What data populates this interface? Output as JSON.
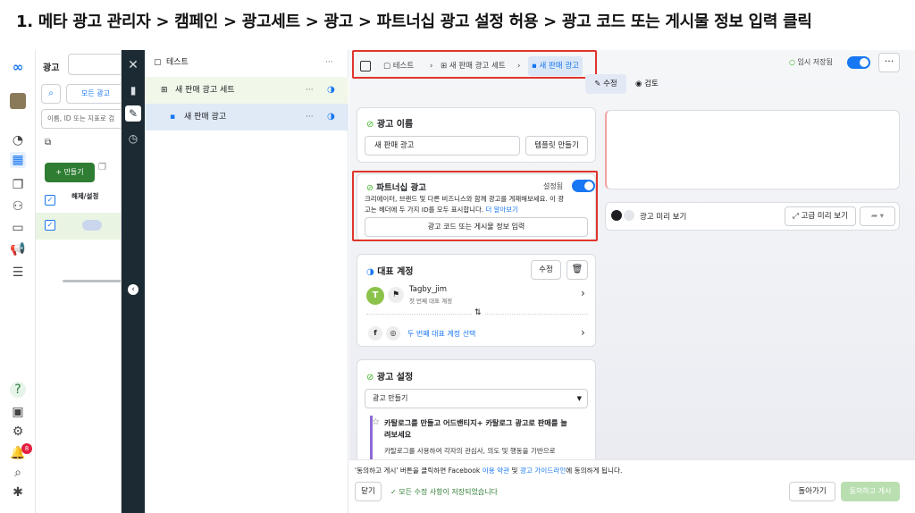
{
  "caption": "1. 메타 광고 관리자 > 캠페인 > 광고세트 > 광고 > 파트너십 광고 설정 허용 > 광고 코드 또는 게시물 정보 입력 클릭",
  "left": {
    "tab": "광고",
    "search_placeholder": "이름, ID 또는 지표로 검",
    "all_ads": "모든 광고",
    "create": "+ 만들기",
    "col_header": "해제/설정"
  },
  "tree": {
    "campaign": "테스트",
    "adset": "새 판매 광고 세트",
    "ad": "새 판매 광고"
  },
  "breadcrumb": {
    "campaign": "테스트",
    "adset": "새 판매 광고 세트",
    "ad": "새 판매 광고"
  },
  "header": {
    "saved": "임시 저장됨",
    "edit_tab": "수정",
    "review_tab": "검토"
  },
  "ad_name": {
    "title": "광고 이름",
    "value": "새 판매 광고",
    "template_btn": "템플릿 만들기"
  },
  "partnership": {
    "title": "파트너십 광고",
    "status": "설정됨",
    "desc1": "크리에이터, 브랜드 및 다른 비즈니스와 함께 광고를 게재해보세요. 이 광",
    "desc2": "고는 헤더에 두 가지 ID를 모두 표시합니다.",
    "learn_more": "더 알아보기",
    "button": "광고 코드 또는 게시물 정보 입력"
  },
  "identity": {
    "title": "대표 계정",
    "edit_btn": "수정",
    "account_name": "Tagby_jim",
    "account_sub": "첫 번째 대표 계정",
    "second": "두 번째 대표 계정 선택",
    "avatar_letter": "T"
  },
  "ad_setup": {
    "title": "광고 설정",
    "select": "광고 만들기",
    "promo_title1": "카탈로그를 만들고 어드밴티지+ 카탈로그 광고로 판매를 늘",
    "promo_title2": "려보세요",
    "promo_body": "카탈로그를 사용하여 각자의 관심사, 의도 및 행동을 기반으로"
  },
  "preview": {
    "label": "광고 미리 보기",
    "advanced": "고급 미리 보기"
  },
  "footer": {
    "notice_pre": "'동의하고 게시' 버튼을 클릭하면 Facebook ",
    "terms": "이용 약관",
    "and": " 및 ",
    "guidelines": "광고 가이드라인",
    "notice_post": "에 동의하게 됩니다.",
    "close": "닫기",
    "saved_msg": "모든 수정 사항이 저장되었습니다",
    "back": "돌아가기",
    "publish": "동의하고 게시"
  },
  "colors": {
    "accent": "#1877f2",
    "red": "#e0352b",
    "green": "#42b72a",
    "dark": "#1c2b33"
  },
  "notification_count": "8"
}
